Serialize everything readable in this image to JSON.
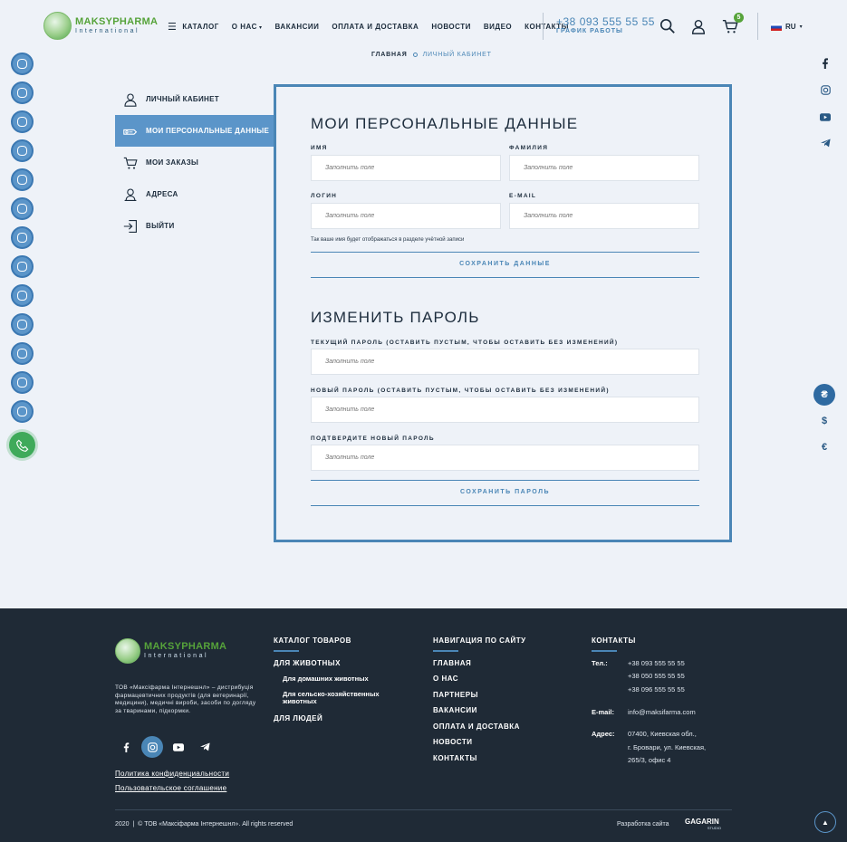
{
  "header": {
    "logo_main": "MAKSYPHARMA",
    "logo_sub": "International",
    "nav": [
      "КАТАЛОГ",
      "О НАС",
      "ВАКАНСИИ",
      "ОПЛАТА И ДОСТАВКА",
      "НОВОСТИ",
      "ВИДЕО",
      "КОНТАКТЫ"
    ],
    "phone": "+38 093 555 55 55",
    "schedule": "ГРАФИК РАБОТЫ",
    "cart_count": "5",
    "lang": "RU"
  },
  "breadcrumb": {
    "home": "ГЛАВНАЯ",
    "current": "ЛИЧНЫЙ КАБИНЕТ"
  },
  "menu": [
    {
      "label": "ЛИЧНЫЙ КАБИНЕТ",
      "icon": "user-icon",
      "active": false
    },
    {
      "label": "МОИ ПЕРСОНАЛЬНЫЕ ДАННЫЕ",
      "icon": "id-card-icon",
      "active": true
    },
    {
      "label": "МОИ ЗАКАЗЫ",
      "icon": "cart-icon",
      "active": false
    },
    {
      "label": "АДРЕСА",
      "icon": "user-pin-icon",
      "active": false
    },
    {
      "label": "ВЫЙТИ",
      "icon": "logout-icon",
      "active": false
    }
  ],
  "profile": {
    "title": "МОИ ПЕРСОНАЛЬНЫЕ ДАННЫЕ",
    "first_name_label": "ИМЯ",
    "last_name_label": "ФАМИЛИЯ",
    "login_label": "ЛОГИН",
    "email_label": "E-MAIL",
    "placeholder": "Заполнить поле",
    "hint": "Так ваше имя будет отображаться в разделе учётной записи",
    "save": "СОХРАНИТЬ ДАННЫЕ"
  },
  "password": {
    "title": "ИЗМЕНИТЬ ПАРОЛЬ",
    "current_label": "ТЕКУЩИЙ ПАРОЛЬ (ОСТАВИТЬ ПУСТЫМ, ЧТОБЫ ОСТАВИТЬ БЕЗ ИЗМЕНЕНИЙ)",
    "new_label": "НОВЫЙ ПАРОЛЬ (ОСТАВИТЬ ПУСТЫМ, ЧТОБЫ ОСТАВИТЬ БЕЗ ИЗМЕНЕНИЙ)",
    "confirm_label": "ПОДТВЕРДИТЕ НОВЫЙ ПАРОЛЬ",
    "placeholder": "Заполнить поле",
    "save": "СОХРАНИТЬ ПАРОЛЬ"
  },
  "currencies": [
    "₴",
    "$",
    "€"
  ],
  "footer": {
    "logo_main": "MAKSYPHARMA",
    "logo_sub": "International",
    "description": "ТОВ «Максіфарма Інтернешнл» – дистрибуція фармацевтичних продуктів (для ветеринарії, медицини), медичні вироби, засоби по догляду за тваринами, підкормки.",
    "catalog_title": "КАТАЛОГ ТОВАРОВ",
    "catalog": {
      "animals": "ДЛЯ ЖИВОТНЫХ",
      "pets": "Для домашних животных",
      "farm": "Для сельско-хозяйственных животных",
      "people": "ДЛЯ ЛЮДЕЙ"
    },
    "nav_title": "НАВИГАЦИЯ ПО САЙТУ",
    "nav": [
      "ГЛАВНАЯ",
      "О НАС",
      "ПАРТНЕРЫ",
      "ВАКАНСИИ",
      "ОПЛАТА И ДОСТАВКА",
      "НОВОСТИ",
      "КОНТАКТЫ"
    ],
    "contacts_title": "КОНТАКТЫ",
    "tel_label": "Тел.:",
    "phones": [
      "+38 093 555 55 55",
      "+38 050 555 55 55",
      "+38 096 555 55 55"
    ],
    "email_label": "E-mail:",
    "email": "info@maksifarma.com",
    "address_label": "Адрес:",
    "address": [
      "07400, Киевская обл.,",
      "г. Бровари, ул. Киевская,",
      "265/3, офис 4"
    ],
    "privacy": "Политика конфиденциальности",
    "agreement": "Пользовательское соглашение",
    "copyright": "2020  |  © ТОВ «Максіфарма Інтернешнл». All rights reserved",
    "dev_label": "Разработка сайта",
    "dev_name": "GAGARIN",
    "dev_sub": "STUDIO"
  }
}
